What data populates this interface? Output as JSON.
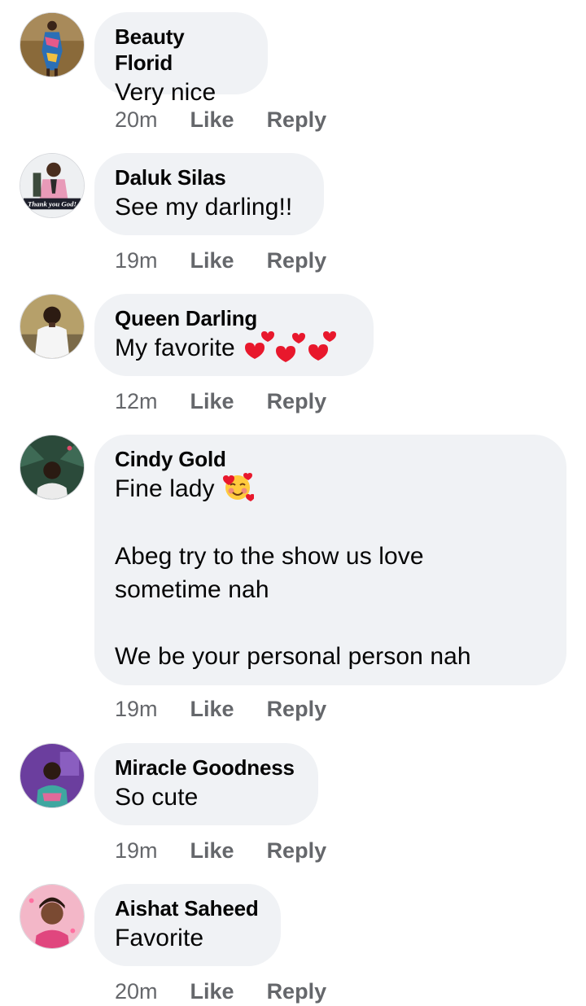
{
  "comments": [
    {
      "author": "Beauty Florid",
      "text": "Very nice",
      "time": "20m",
      "like_label": "Like",
      "reply_label": "Reply"
    },
    {
      "author": "Daluk Silas",
      "text": "See my darling!!",
      "time": "19m",
      "like_label": "Like",
      "reply_label": "Reply",
      "avatar_caption": "Thank you God!"
    },
    {
      "author": "Queen Darling",
      "text": "My favorite",
      "emoji": "revolving-hearts x3",
      "time": "12m",
      "like_label": "Like",
      "reply_label": "Reply"
    },
    {
      "author": "Cindy Gold",
      "text_line1": "Fine lady",
      "emoji": "smiling-face-with-hearts",
      "text_rest": "Abeg try to the show us love\nsometime nah\n\nWe be your personal person nah",
      "time": "19m",
      "like_label": "Like",
      "reply_label": "Reply"
    },
    {
      "author": "Miracle Goodness",
      "text": "So cute",
      "time": "19m",
      "like_label": "Like",
      "reply_label": "Reply"
    },
    {
      "author": "Aishat Saheed",
      "text": "Favorite",
      "time": "20m",
      "like_label": "Like",
      "reply_label": "Reply"
    }
  ],
  "colors": {
    "bubble": "#f0f2f5",
    "meta": "#65676b",
    "text": "#050505"
  }
}
